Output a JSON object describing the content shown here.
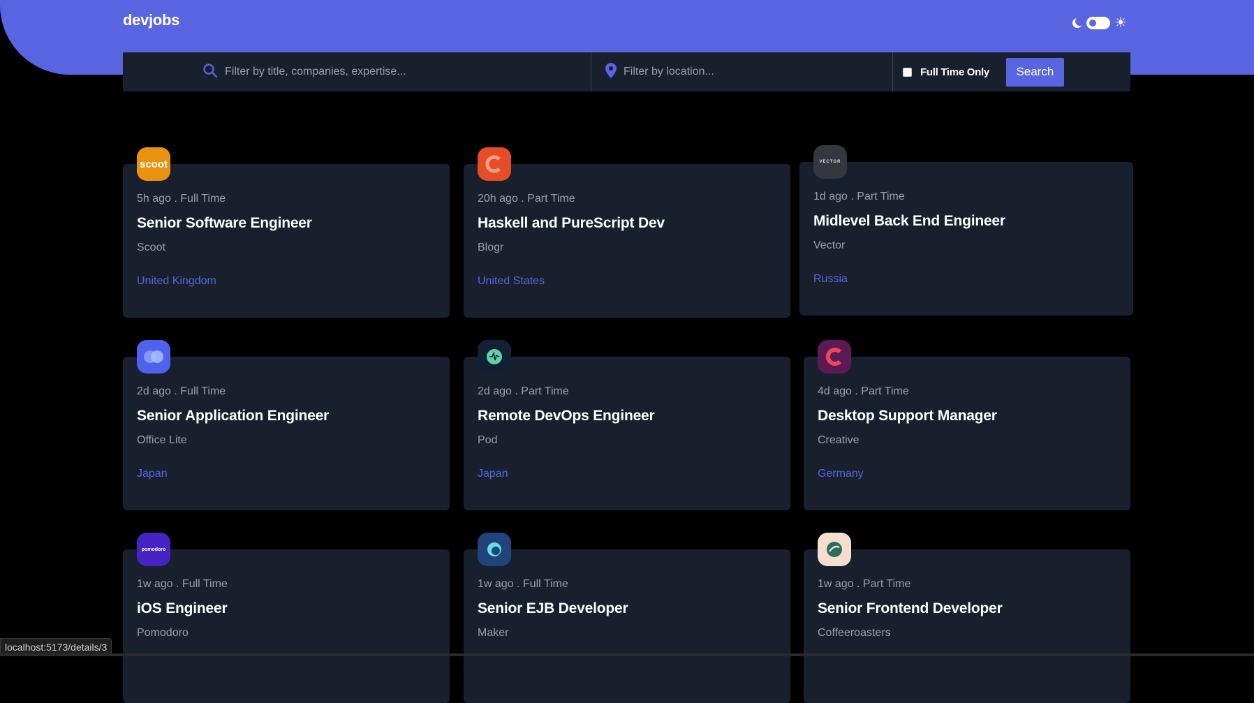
{
  "app": {
    "logo": "devjobs"
  },
  "colors": {
    "accent": "#5964e0",
    "card_bg": "#19202d",
    "page_bg": "#000000"
  },
  "search": {
    "title_placeholder": "Filter by title, companies, expertise...",
    "location_placeholder": "Filter by location...",
    "full_time_label": "Full Time Only",
    "full_time_checked": false,
    "button_label": "Search"
  },
  "theme": {
    "dark_icon": "moon-icon",
    "light_icon": "sun-icon",
    "glyph_sun": "☀"
  },
  "jobs": [
    {
      "logo_text": "scoot",
      "logo_color": "#e99210",
      "meta": "5h ago . Full Time",
      "title": "Senior Software Engineer",
      "company": "Scoot",
      "location": "United Kingdom"
    },
    {
      "logo_text": "",
      "logo_color": "#e54d26",
      "meta": "20h ago . Part Time",
      "title": "Haskell and PureScript Dev",
      "company": "Blogr",
      "location": "United States"
    },
    {
      "logo_text": "VECTOR",
      "logo_color": "#36363e",
      "meta": "1d ago . Part Time",
      "title": "Midlevel Back End Engineer",
      "company": "Vector",
      "location": "Russia"
    },
    {
      "logo_text": "",
      "logo_color": "#4e62ee",
      "meta": "2d ago . Full Time",
      "title": "Senior Application Engineer",
      "company": "Office Lite",
      "location": "Japan"
    },
    {
      "logo_text": "",
      "logo_color": "#132034",
      "meta": "2d ago . Part Time",
      "title": "Remote DevOps Engineer",
      "company": "Pod",
      "location": "Japan"
    },
    {
      "logo_text": "",
      "logo_color": "#5c1a55",
      "meta": "4d ago . Part Time",
      "title": "Desktop Support Manager",
      "company": "Creative",
      "location": "Germany"
    },
    {
      "logo_text": "pomodoro",
      "logo_color": "#4722c4",
      "meta": "1w ago . Full Time",
      "title": "iOS Engineer",
      "company": "Pomodoro",
      "location": ""
    },
    {
      "logo_text": "",
      "logo_color": "#21437d",
      "meta": "1w ago . Full Time",
      "title": "Senior EJB Developer",
      "company": "Maker",
      "location": ""
    },
    {
      "logo_text": "",
      "logo_color": "#f4dfcf",
      "meta": "1w ago . Part Time",
      "title": "Senior Frontend Developer",
      "company": "Coffeeroasters",
      "location": ""
    }
  ],
  "status_bar": {
    "url": "localhost:5173/details/3"
  }
}
